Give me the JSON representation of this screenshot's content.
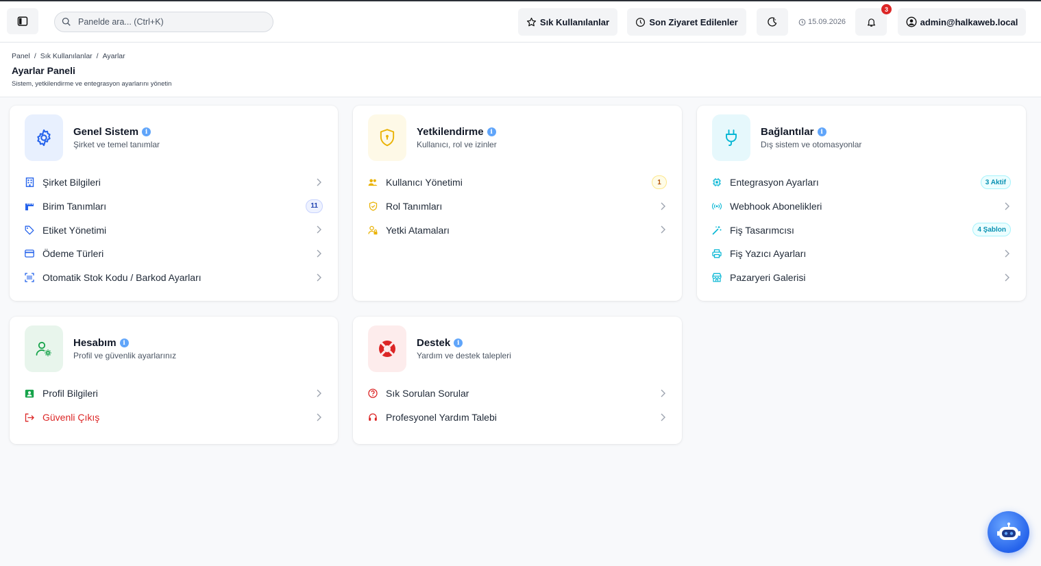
{
  "topbar": {
    "search_placeholder": "Panelde ara... (Ctrl+K)",
    "favorites_label": "Sık Kullanılanlar",
    "recent_label": "Son Ziyaret Edilenler",
    "date": "15.09.2026",
    "notification_count": "3",
    "user_label": "admin@halkaweb.local"
  },
  "header": {
    "breadcrumb": [
      "Panel",
      "/",
      "Sık Kullanılanlar",
      "/",
      "Ayarlar"
    ],
    "title": "Ayarlar Paneli",
    "subtitle": "Sistem, yetkilendirme ve entegrasyon ayarlarını yönetin"
  },
  "cards": {
    "general": {
      "title": "Genel Sistem",
      "subtitle": "Şirket ve temel tanımlar",
      "items": [
        {
          "label": "Şirket Bilgileri"
        },
        {
          "label": "Birim Tanımları",
          "badge": "11"
        },
        {
          "label": "Etiket Yönetimi"
        },
        {
          "label": "Ödeme Türleri"
        },
        {
          "label": "Otomatik Stok Kodu / Barkod Ayarları"
        }
      ]
    },
    "auth": {
      "title": "Yetkilendirme",
      "subtitle": "Kullanıcı, rol ve izinler",
      "items": [
        {
          "label": "Kullanıcı Yönetimi",
          "badge": "1"
        },
        {
          "label": "Rol Tanımları"
        },
        {
          "label": "Yetki Atamaları"
        }
      ]
    },
    "connections": {
      "title": "Bağlantılar",
      "subtitle": "Dış sistem ve otomasyonlar",
      "items": [
        {
          "label": "Entegrasyon Ayarları",
          "badge": "3 Aktif"
        },
        {
          "label": "Webhook Abonelikleri"
        },
        {
          "label": "Fiş Tasarımcısı",
          "badge": "4 Şablon"
        },
        {
          "label": "Fiş Yazıcı Ayarları"
        },
        {
          "label": "Pazaryeri Galerisi"
        }
      ]
    },
    "account": {
      "title": "Hesabım",
      "subtitle": "Profil ve güvenlik ayarlarınız",
      "items": [
        {
          "label": "Profil Bilgileri"
        },
        {
          "label": "Güvenli Çıkış"
        }
      ]
    },
    "support": {
      "title": "Destek",
      "subtitle": "Yardım ve destek talepleri",
      "items": [
        {
          "label": "Sık Sorulan Sorular"
        },
        {
          "label": "Profesyonel Yardım Talebi"
        }
      ]
    }
  },
  "colors": {
    "general_accent": "#2563eb",
    "auth_accent": "#eab308",
    "connections_accent": "#06b6d4",
    "account_accent": "#16a34a",
    "support_accent": "#dc2626",
    "danger": "#dc2626"
  }
}
